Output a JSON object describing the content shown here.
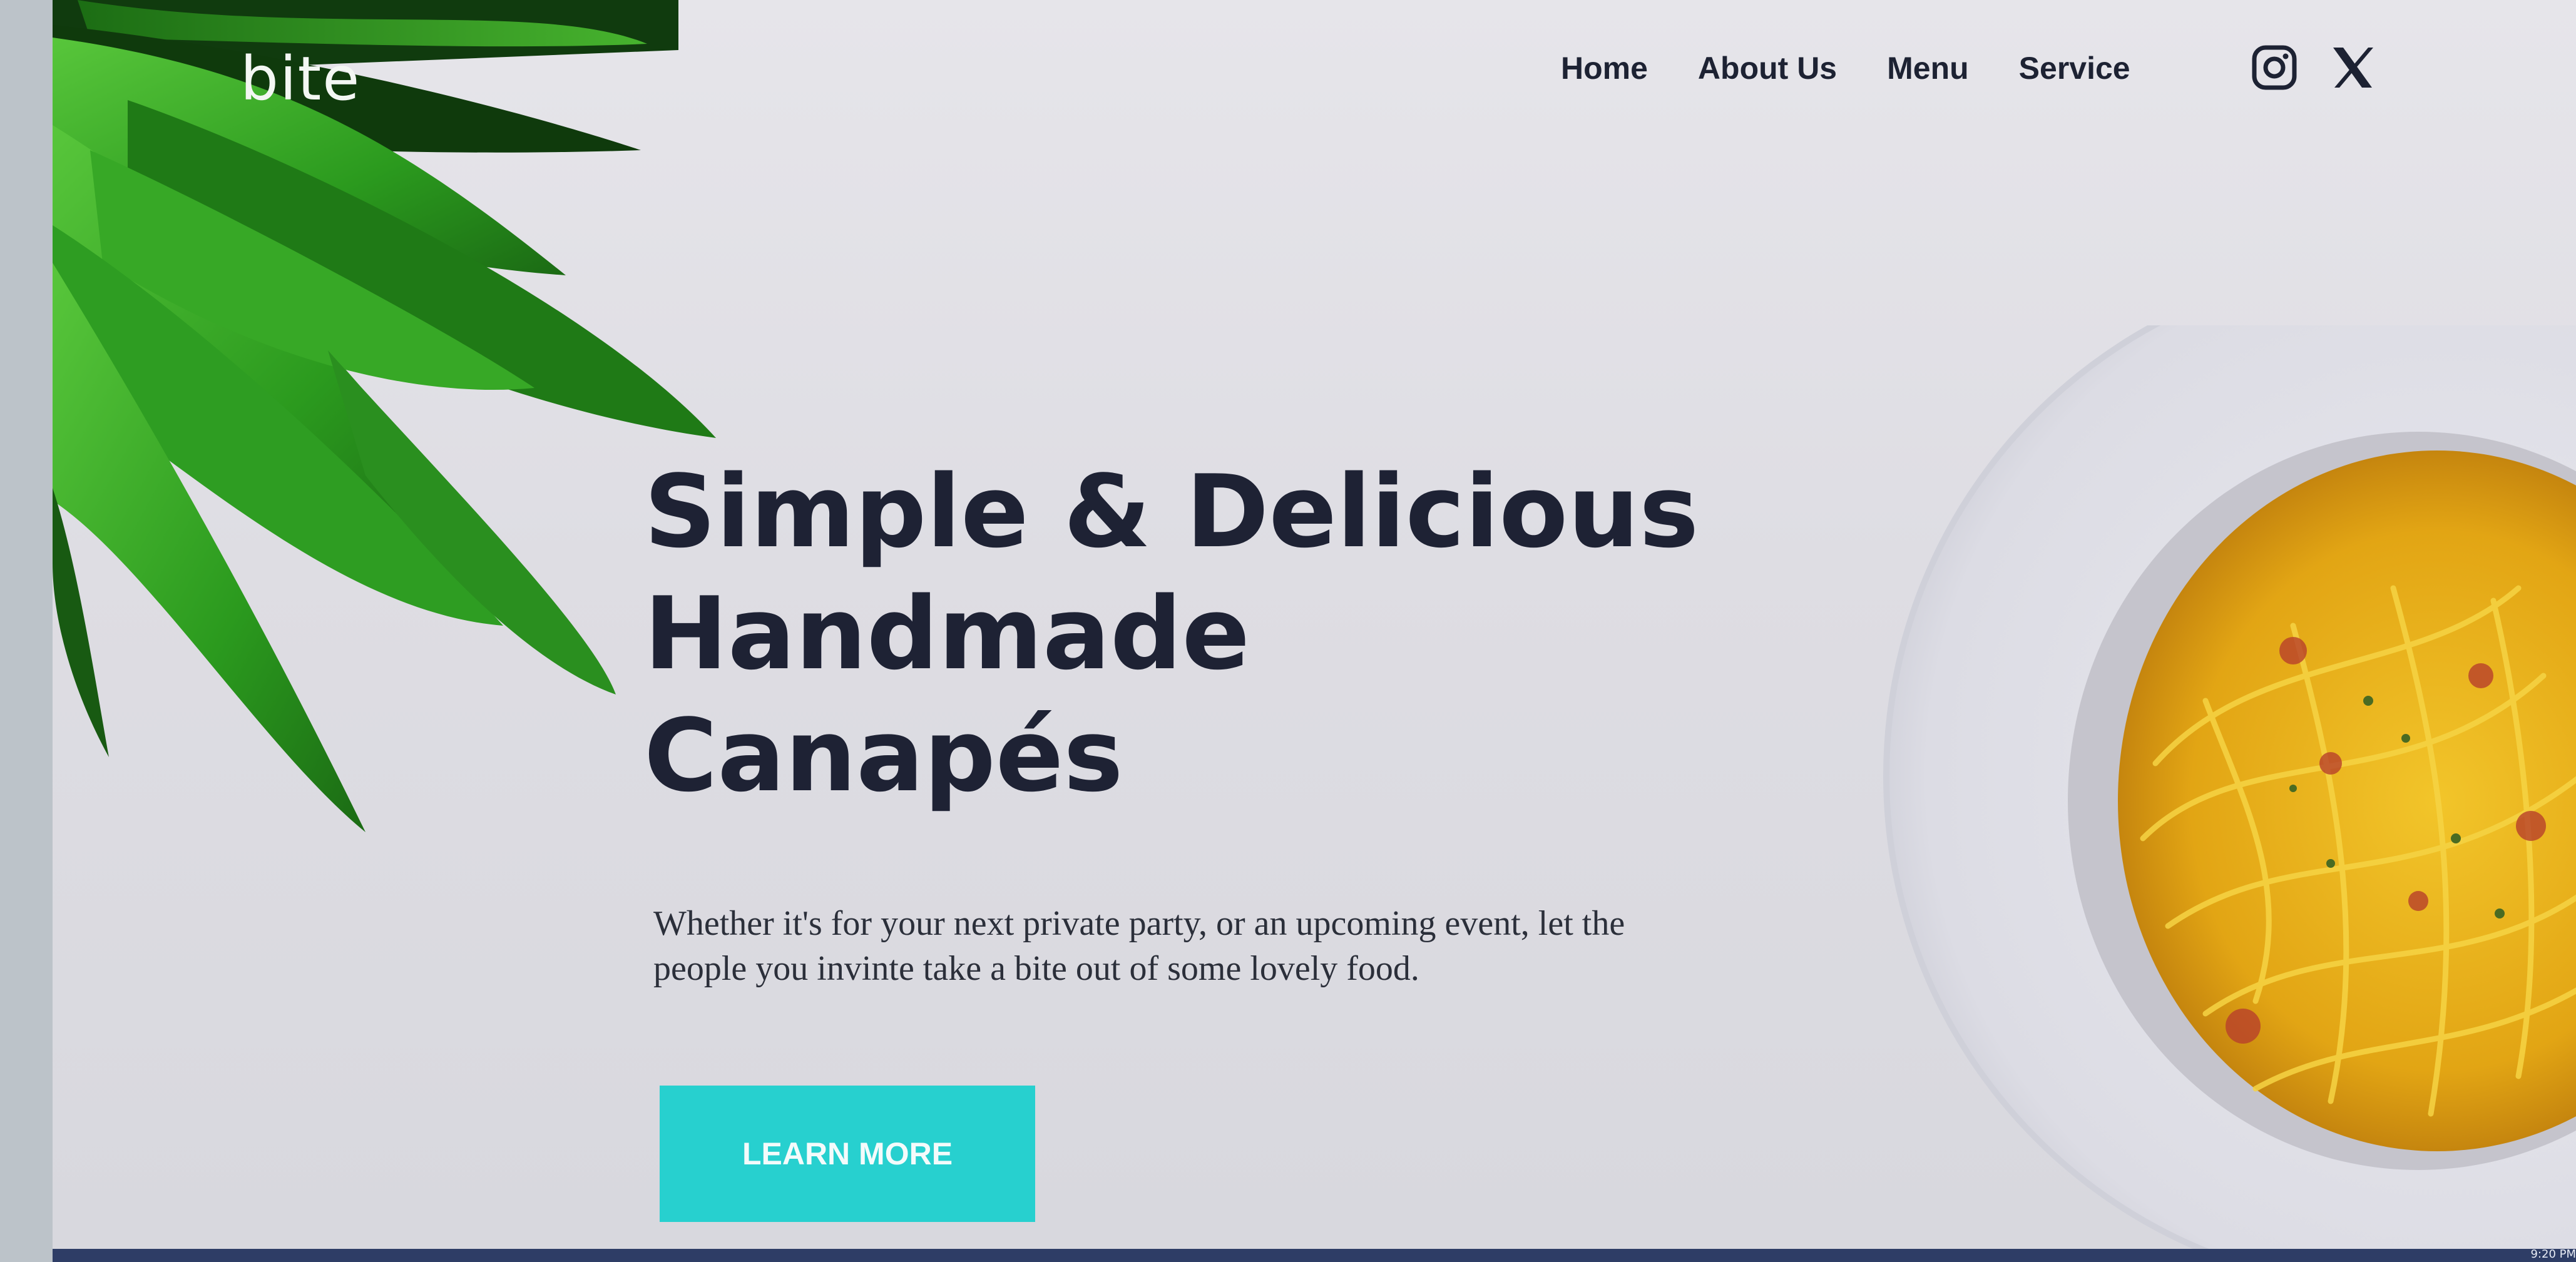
{
  "brand": {
    "name": "bite"
  },
  "nav": {
    "items": [
      {
        "label": "Home"
      },
      {
        "label": "About Us"
      },
      {
        "label": "Menu"
      },
      {
        "label": "Service"
      }
    ]
  },
  "social": {
    "instagram_icon": "instagram-icon",
    "x_icon": "x-icon"
  },
  "hero": {
    "headline_lines": [
      "Simple & Delicious",
      "Handmade",
      "Canapés"
    ],
    "tagline_line1": "Whether it's for your next private party, or an upcoming event, let the",
    "tagline_line2": "people you invinte take a bite out of some lovely food.",
    "cta_label": "LEARN MORE"
  },
  "taskbar": {
    "clock": "9:20 PM"
  },
  "colors": {
    "accent": "#27d0cf",
    "text_dark": "#1e2234",
    "page_bg": "#e3e2e7",
    "leaf_green": "#2a9a1f",
    "pasta_yellow": "#e9b21c"
  }
}
